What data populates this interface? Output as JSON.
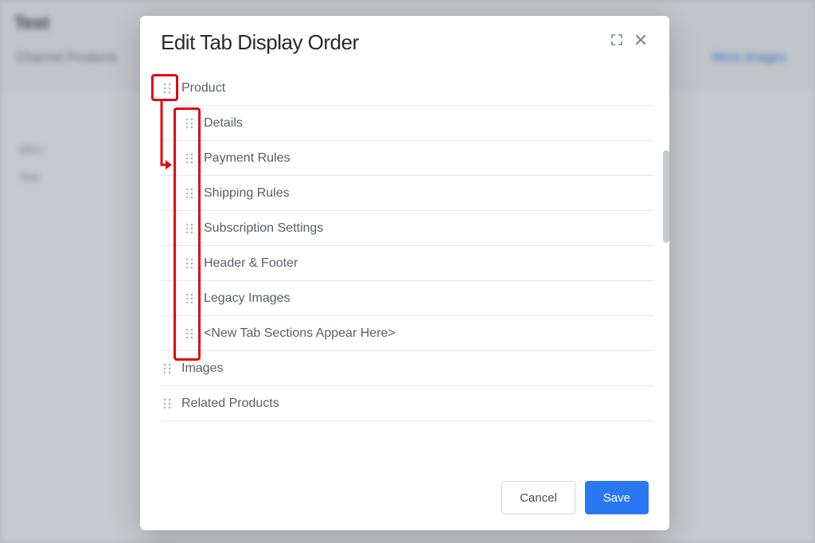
{
  "modal": {
    "title": "Edit Tab Display Order",
    "items": [
      {
        "label": "Product",
        "level": "top"
      },
      {
        "label": "Details",
        "level": "child"
      },
      {
        "label": "Payment Rules",
        "level": "child"
      },
      {
        "label": "Shipping Rules",
        "level": "child"
      },
      {
        "label": "Subscription Settings",
        "level": "child"
      },
      {
        "label": "Header & Footer",
        "level": "child"
      },
      {
        "label": "Legacy Images",
        "level": "child"
      },
      {
        "label": "<New Tab Sections Appear Here>",
        "level": "child"
      },
      {
        "label": "Images",
        "level": "top"
      },
      {
        "label": "Related Products",
        "level": "top"
      }
    ],
    "buttons": {
      "cancel": "Cancel",
      "save": "Save"
    }
  },
  "background": {
    "word1": "Test",
    "word2": "Test"
  }
}
